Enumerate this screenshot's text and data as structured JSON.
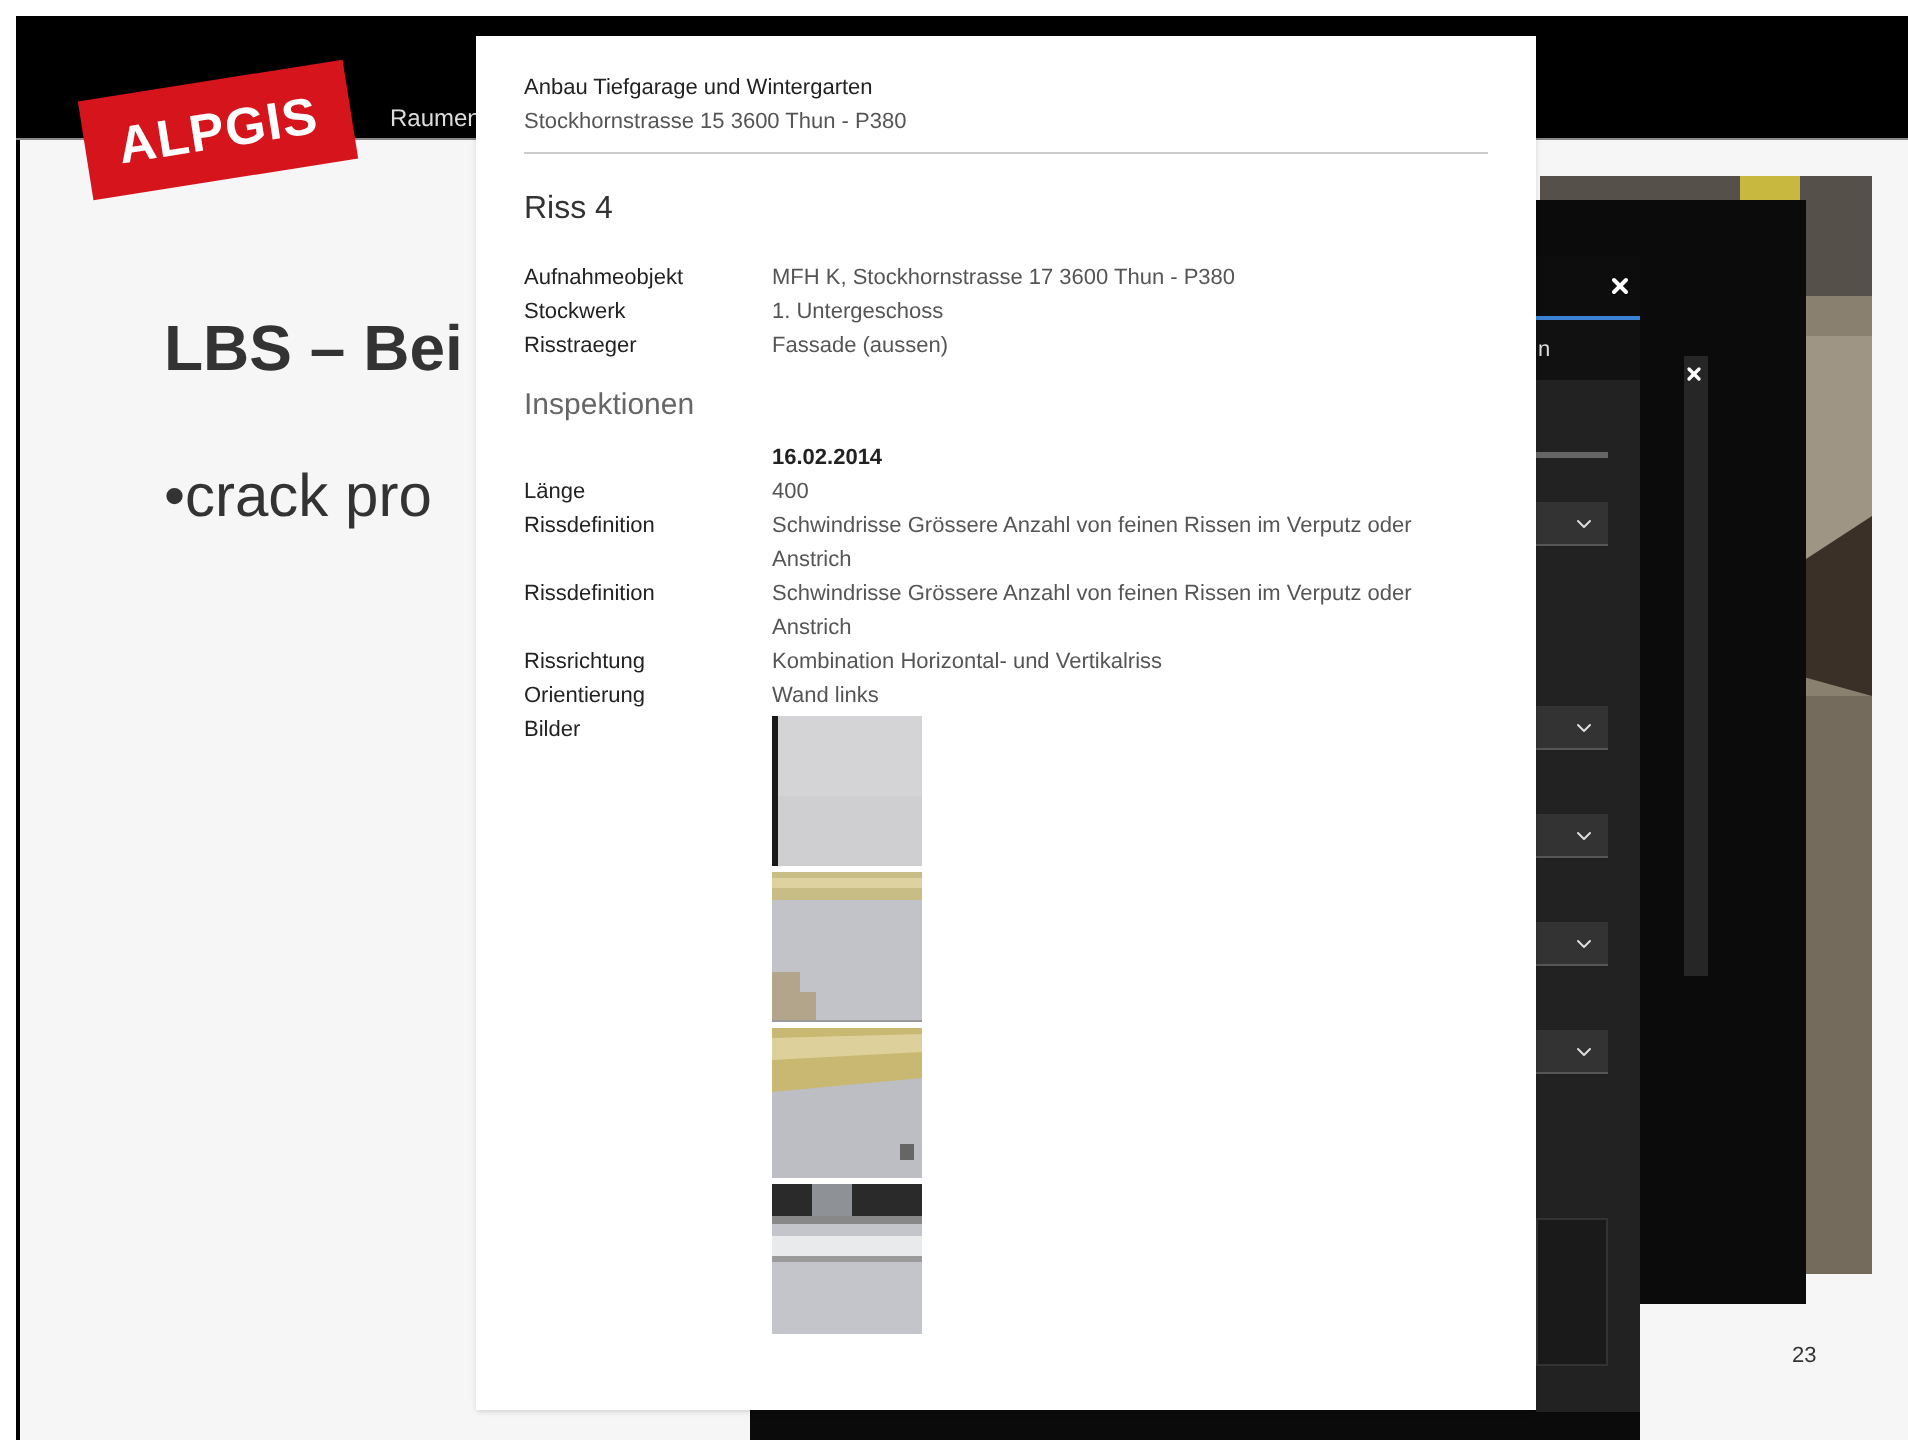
{
  "slide": {
    "logo": "ALPGIS",
    "header_text": "Raumen",
    "title": "LBS – Bei",
    "bullet": "•crack pro",
    "page_number": "23"
  },
  "report": {
    "project": "Anbau Tiefgarage und Wintergarten",
    "address": "Stockhornstrasse 15 3600 Thun - P380",
    "title": "Riss 4",
    "details": [
      {
        "label": "Aufnahmeobjekt",
        "value": "MFH K, Stockhornstrasse 17 3600 Thun - P380"
      },
      {
        "label": "Stockwerk",
        "value": "1. Untergeschoss"
      },
      {
        "label": "Risstraeger",
        "value": "Fassade (aussen)"
      }
    ],
    "section": "Inspektionen",
    "date": "16.02.2014",
    "inspection": [
      {
        "label": "Länge",
        "value": "400"
      },
      {
        "label": "Rissdefinition",
        "value": "Schwindrisse Grössere Anzahl von feinen Rissen im Verputz oder Anstrich"
      },
      {
        "label": "Rissdefinition",
        "value": "Schwindrisse Grössere Anzahl von feinen Rissen im Verputz oder Anstrich"
      },
      {
        "label": "Rissrichtung",
        "value": "Kombination Horizontal- und Vertikalriss"
      },
      {
        "label": "Orientierung",
        "value": "Wand links"
      }
    ],
    "images_label": "Bilder"
  },
  "dark_dialog": {
    "tab_fragment": "n",
    "fields": [
      {
        "kind": "select"
      },
      {
        "kind": "select"
      },
      {
        "kind": "select"
      },
      {
        "kind": "select"
      },
      {
        "kind": "select"
      },
      {
        "kind": "textarea"
      }
    ]
  }
}
